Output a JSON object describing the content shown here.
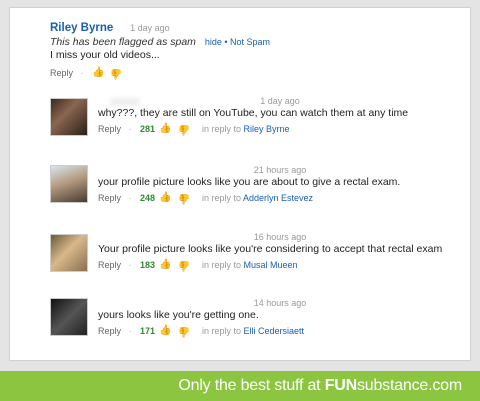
{
  "top_comment": {
    "author": "Riley Byrne",
    "time": "1 day ago",
    "flag_text": "This has been flagged as spam",
    "hide_link": "hide",
    "not_spam_link": "• Not Spam",
    "text": "I miss your old videos...",
    "reply_label": "Reply"
  },
  "replies": [
    {
      "time": "1 day ago",
      "text": "why???, they are still on YouTube, you can watch them at any time",
      "reply_label": "Reply",
      "likes": "281",
      "in_reply_prefix": "in reply to",
      "in_reply_to": "Riley Byrne"
    },
    {
      "time": "21 hours ago",
      "text": "your profile picture looks like you are about to give a rectal exam.",
      "reply_label": "Reply",
      "likes": "248",
      "in_reply_prefix": "in reply to",
      "in_reply_to": "Adderlyn Estevez"
    },
    {
      "time": "16 hours ago",
      "text": "Your profile picture looks like you're considering to accept that rectal exam",
      "reply_label": "Reply",
      "likes": "183",
      "in_reply_prefix": "in reply to",
      "in_reply_to": "Musal Mueen"
    },
    {
      "time": "14 hours ago",
      "text": "yours looks like you're getting one.",
      "reply_label": "Reply",
      "likes": "171",
      "in_reply_prefix": "in reply to",
      "in_reply_to": "Elli Cedersiaett"
    }
  ],
  "footer": {
    "prefix": "Only the best stuff at ",
    "brand_bold": "FUN",
    "brand_rest": "substance.com"
  },
  "colors": {
    "link": "#1a5fb4",
    "likes": "#2e8b2e",
    "footer_bg": "#8cc540"
  }
}
